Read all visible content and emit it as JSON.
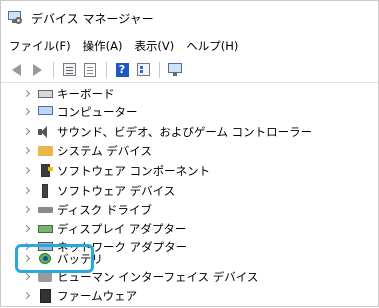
{
  "window": {
    "title": "デバイス マネージャー",
    "app_icon": "device-manager-icon"
  },
  "menu": [
    {
      "label": "ファイル(F)"
    },
    {
      "label": "操作(A)"
    },
    {
      "label": "表示(V)"
    },
    {
      "label": "ヘルプ(H)"
    }
  ],
  "toolbar": {
    "buttons": [
      "back-arrow-icon",
      "forward-arrow-icon",
      "show-hide-console-tree-icon",
      "properties-sheet-icon",
      "help-icon",
      "action-pane-icon",
      "monitor-icon"
    ],
    "help_glyph": "?"
  },
  "tree": {
    "items": [
      {
        "label": "キーボード",
        "icon": "keyboard-icon"
      },
      {
        "label": "コンピューター",
        "icon": "computer-icon"
      },
      {
        "label": "サウンド、ビデオ、およびゲーム コントローラー",
        "icon": "speaker-icon"
      },
      {
        "label": "システム デバイス",
        "icon": "folder-icon"
      },
      {
        "label": "ソフトウェア コンポーネント",
        "icon": "software-component-icon"
      },
      {
        "label": "ソフトウェア デバイス",
        "icon": "software-device-icon"
      },
      {
        "label": "ディスク ドライブ",
        "icon": "disk-drive-icon"
      },
      {
        "label": "ディスプレイ アダプター",
        "icon": "display-adapter-icon"
      },
      {
        "label": "ネットワーク アダプター",
        "icon": "network-adapter-icon"
      },
      {
        "label": "バッテリ",
        "icon": "battery-icon",
        "highlighted": true
      },
      {
        "label": "ヒューマン インターフェイス デバイス",
        "icon": "hid-icon"
      },
      {
        "label": "ファームウェア",
        "icon": "firmware-icon"
      }
    ]
  },
  "colors": {
    "highlight_border": "#29a8e0",
    "help_icon": "#1f57c3"
  }
}
